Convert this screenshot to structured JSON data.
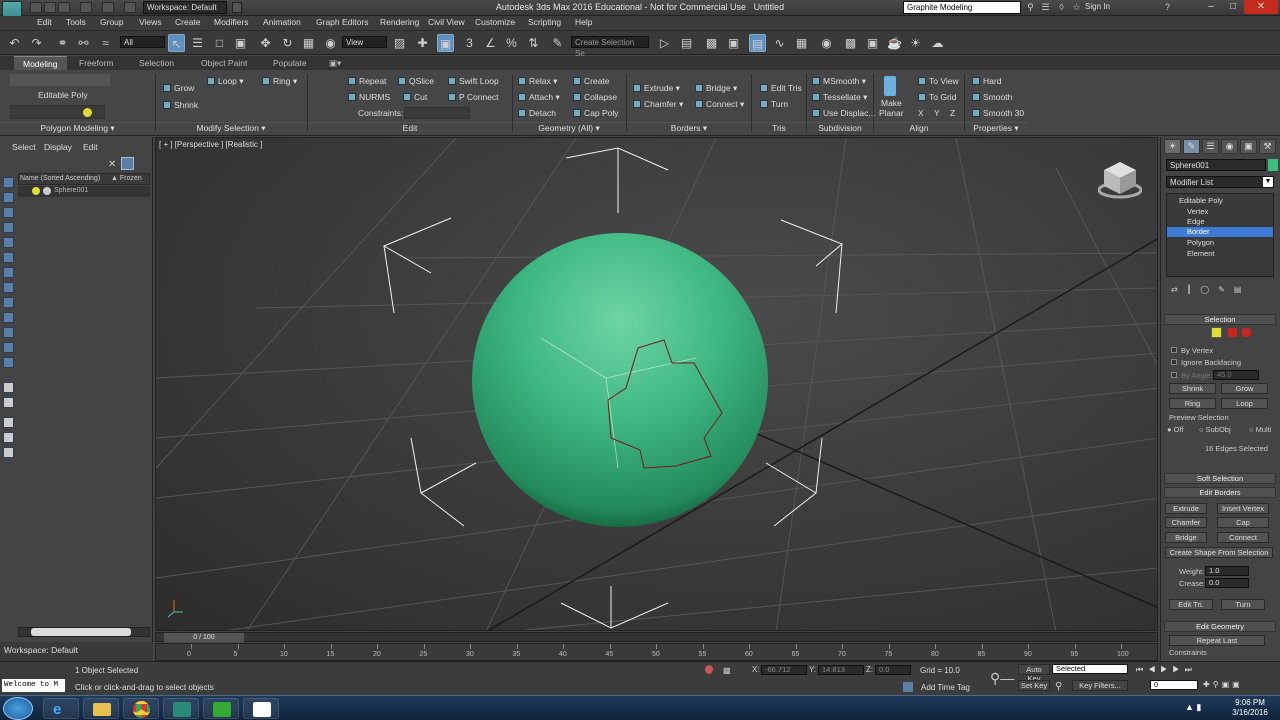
{
  "app": {
    "title": "Autodesk 3ds Max 2016 Educational - Not for Commercial Use",
    "doc": "Untitled",
    "logo": "MAX",
    "workspace": "Workspace: Default",
    "search": "Graphite Modeling",
    "signin": "Sign In"
  },
  "menu": [
    "Edit",
    "Tools",
    "Group",
    "Views",
    "Create",
    "Modifiers",
    "Animation",
    "Graph Editors",
    "Rendering",
    "Civil View",
    "Customize",
    "Scripting",
    "Help"
  ],
  "toolbar": {
    "filter": "All",
    "coord": "View",
    "named_selection": "Create Selection Se"
  },
  "ribbon": {
    "tabs": [
      "Modeling",
      "Freeform",
      "Selection",
      "Object Paint",
      "Populate"
    ],
    "active_tab": "Modeling",
    "poly": {
      "label": "Editable Poly",
      "panel": "Polygon Modeling"
    },
    "modsel": {
      "grow": "Grow",
      "shrink": "Shrink",
      "loop": "Loop",
      "ring": "Ring",
      "panel": "Modify Selection"
    },
    "edit": {
      "repeat": "Repeat",
      "qslice": "QSlice",
      "swift": "Swift Loop",
      "nurms": "NURMS",
      "cut": "Cut",
      "pconnect": "P Connect",
      "constraints": "Constraints:",
      "panel": "Edit"
    },
    "geometry": {
      "relax": "Relax",
      "create": "Create",
      "attach": "Attach",
      "collapse": "Collapse",
      "detach": "Detach",
      "cappoly": "Cap Poly",
      "panel": "Geometry (All)"
    },
    "borders": {
      "extrude": "Extrude",
      "bridge": "Bridge",
      "chamfer": "Chamfer",
      "connect": "Connect",
      "panel": "Borders"
    },
    "tris": {
      "edittris": "Edit Tris",
      "turn": "Turn",
      "panel": "Tris"
    },
    "subdiv": {
      "msmooth": "MSmooth",
      "tess": "Tessellate",
      "usedisp": "Use Displac...",
      "panel": "Subdivision"
    },
    "align": {
      "make": "Make",
      "planar": "Planar",
      "toview": "To View",
      "togrid": "To Grid",
      "x": "X",
      "y": "Y",
      "z": "Z",
      "panel": "Align"
    },
    "props": {
      "hard": "Hard",
      "smooth": "Smooth",
      "smooth30": "Smooth 30",
      "panel": "Properties"
    }
  },
  "explorer": {
    "tabs": [
      "Select",
      "Display",
      "Edit"
    ],
    "col_name": "Name (Sorted Ascending)",
    "col_frozen": "▲ Frozen",
    "rows": [
      "Sphere001"
    ]
  },
  "viewport": {
    "label": "[ + ] [Perspective ] [Realistic ]",
    "sphere_color": "#3aa878"
  },
  "cmd": {
    "object": "Sphere001",
    "modlist": "Modifier List",
    "stack": [
      "Editable Poly",
      "Vertex",
      "Edge",
      "Border",
      "Polygon",
      "Element"
    ],
    "selected_stack": "Border",
    "selection": "Selection",
    "byvertex": "By Vertex",
    "ignoreback": "Ignore Backfacing",
    "byangle": "By Angle:",
    "angle": "45.0",
    "shrink": "Shrink",
    "grow": "Grow",
    "ring": "Ring",
    "loop": "Loop",
    "preview": "Preview Selection",
    "off": "Off",
    "subobj": "SubObj",
    "multi": "Multi",
    "selcount": "16 Edges Selected",
    "softsel": "Soft Selection",
    "editborders": "Edit Borders",
    "extrude": "Extrude",
    "insert": "Insert Vertex",
    "chamfer": "Chamfer",
    "cap": "Cap",
    "bridge": "Bridge",
    "connect": "Connect",
    "createshape": "Create Shape From Selection",
    "weight": "Weight:",
    "weight_v": "1.0",
    "crease": "Crease:",
    "crease_v": "0.0",
    "edittri": "Edit Tri.",
    "turn": "Turn",
    "editgeo": "Edit Geometry",
    "repeat": "Repeat Last",
    "constraints": "Constraints"
  },
  "timeline": {
    "frame": "0 / 100",
    "ticks": [
      "0",
      "5",
      "10",
      "15",
      "20",
      "25",
      "30",
      "35",
      "40",
      "45",
      "50",
      "55",
      "60",
      "65",
      "70",
      "75",
      "80",
      "85",
      "90",
      "95",
      "100"
    ]
  },
  "status": {
    "selected": "1 Object Selected",
    "hint": "Click or click-and-drag to select objects",
    "welcome": "Welcome to M",
    "x": "-66.712",
    "y": "14.813",
    "z": "0.0",
    "grid": "Grid = 10.0",
    "addtag": "Add Time Tag",
    "autokey": "Auto Key",
    "setkey": "Set Key",
    "mode": "Selected",
    "keyfilters": "Key Filters...",
    "frame": "0"
  },
  "clock": {
    "time": "9:06 PM",
    "date": "3/16/2016"
  }
}
